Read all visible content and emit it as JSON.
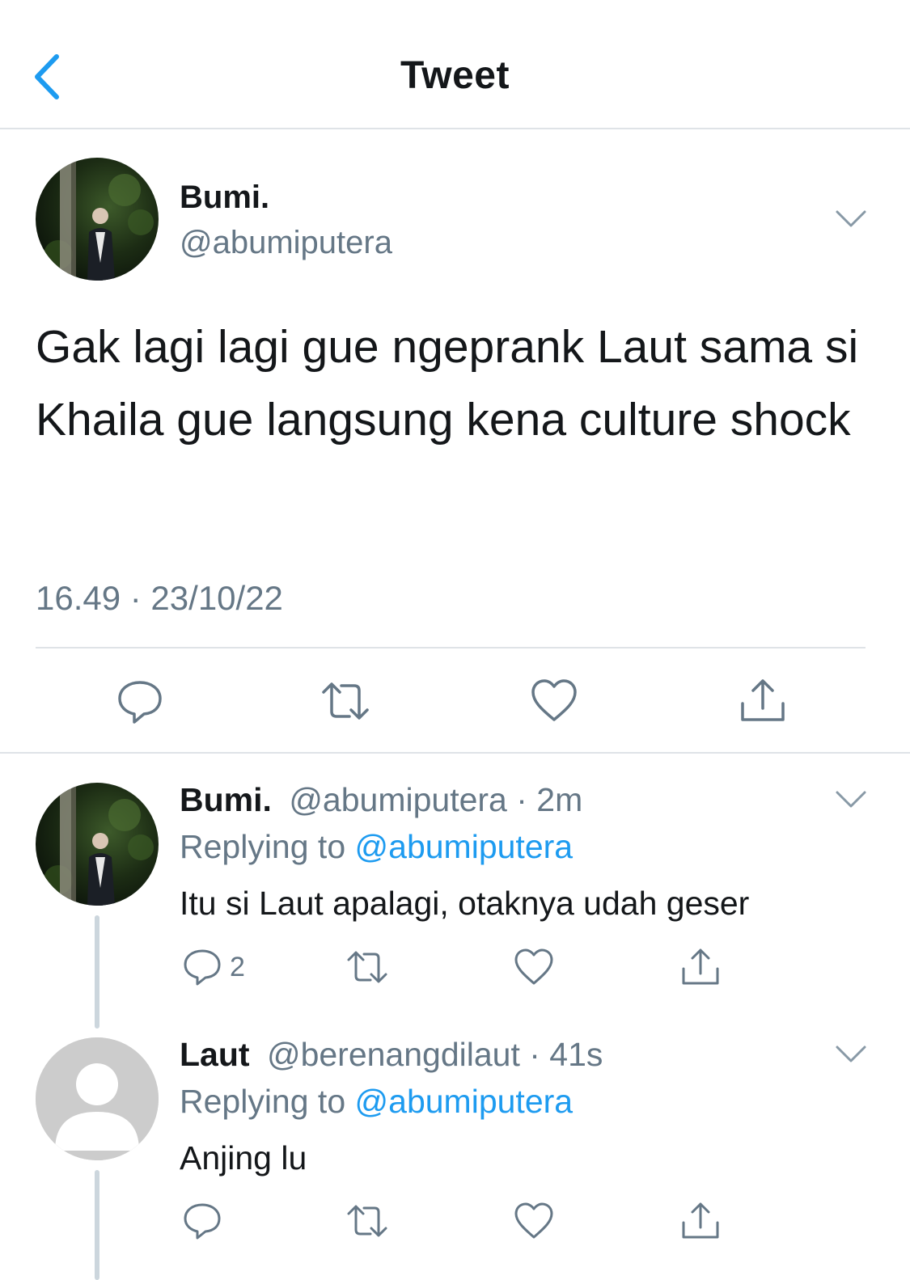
{
  "nav": {
    "title": "Tweet"
  },
  "main_tweet": {
    "name": "Bumi.",
    "handle": "@abumiputera",
    "text": "Gak lagi lagi gue ngeprank Laut sama si Khaila gue langsung kena culture shock",
    "timestamp": "16.49 · 23/10/22"
  },
  "replies": [
    {
      "name": "Bumi.",
      "handle": "@abumiputera",
      "age": "2m",
      "replying_label": "Replying to",
      "replying_to": "@abumiputera",
      "text": "Itu si Laut apalagi, otaknya udah geser",
      "reply_count": "2"
    },
    {
      "name": "Laut",
      "handle": "@berenangdilaut",
      "age": "41s",
      "replying_label": "Replying to",
      "replying_to": "@abumiputera",
      "text": "Anjing lu",
      "reply_count": ""
    }
  ],
  "colors": {
    "accent": "#1d9bf0",
    "secondary_text": "#657786",
    "divider": "#dfe3e7",
    "icon": "#657786"
  },
  "icons": [
    "back-chevron-icon",
    "chevron-down-icon",
    "reply-icon",
    "retweet-icon",
    "like-icon",
    "share-icon"
  ]
}
